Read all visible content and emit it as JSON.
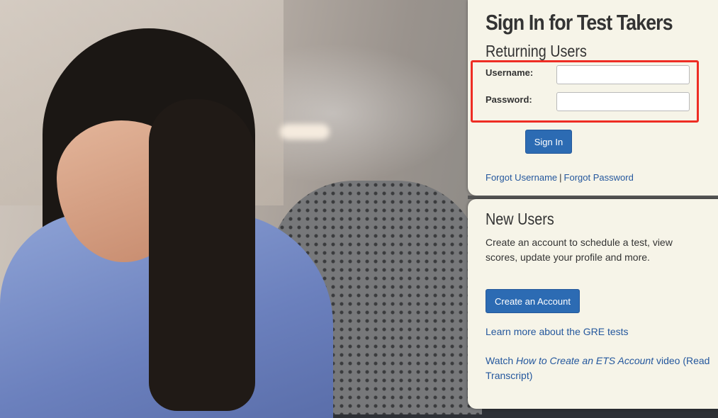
{
  "signin": {
    "title": "Sign In for Test Takers",
    "subtitle": "Returning Users",
    "username_label": "Username:",
    "username_value": "",
    "password_label": "Password:",
    "password_value": "",
    "signin_button": "Sign In",
    "forgot_username": "Forgot Username",
    "separator": "|",
    "forgot_password": "Forgot Password"
  },
  "new_users": {
    "title": "New Users",
    "description": "Create an account to schedule a test, view scores, update your profile and more.",
    "create_button": "Create an Account",
    "learn_more": "Learn more about the GRE tests",
    "watch_prefix": "Watch ",
    "watch_video_title": "How to Create an ETS Account",
    "watch_suffix": " video",
    "transcript_link": "(Read Transcript)"
  },
  "colors": {
    "panel_bg": "#f6f4e8",
    "button_blue": "#2c6bb3",
    "link_blue": "#24579d",
    "highlight_red": "#ee2d24"
  }
}
